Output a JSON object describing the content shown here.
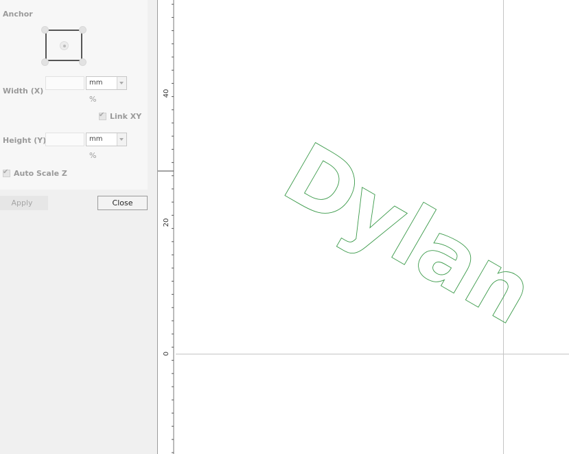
{
  "panel": {
    "anchor_label": "Anchor",
    "width_label": "Width (X)",
    "width_value": "",
    "width_unit": "mm",
    "width_percent": "%",
    "link_label": "Link XY",
    "link_checked": true,
    "height_label": "Height (Y)",
    "height_value": "",
    "height_unit": "mm",
    "height_percent": "%",
    "autoscale_label": "Auto Scale Z",
    "autoscale_checked": true,
    "apply_label": "Apply",
    "close_label": "Close"
  },
  "canvas": {
    "ruler_labels": [
      "40",
      "20",
      "0"
    ],
    "text_outline": "Dylan",
    "outline_color": "#3b9a4a"
  }
}
